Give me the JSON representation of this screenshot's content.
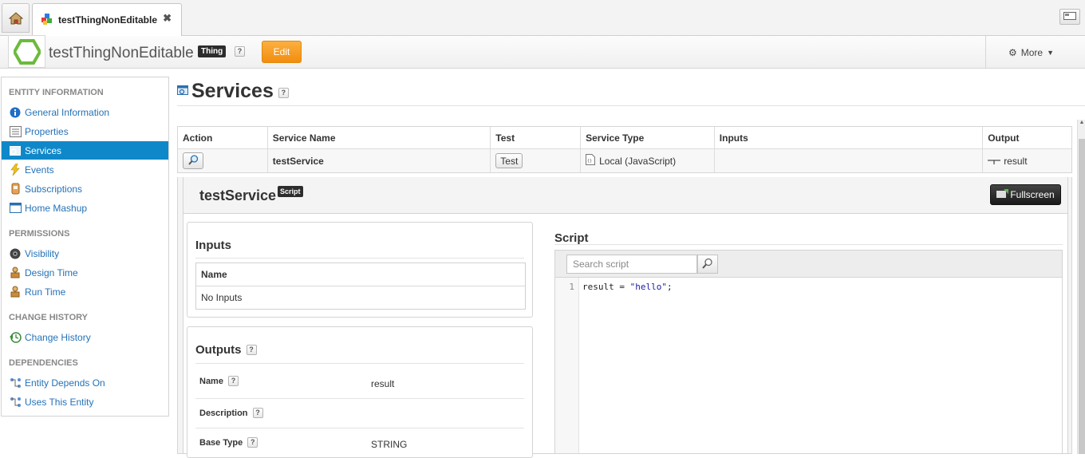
{
  "tabs": {
    "home_icon": "home-icon",
    "entity_tab_label": "testThingNonEditable",
    "close_glyph": "✖"
  },
  "header": {
    "entity_name": "testThingNonEditable",
    "type_badge": "Thing",
    "help": "?",
    "edit_label": "Edit",
    "more_label": "More",
    "accent_color": "#f28d10"
  },
  "sidebar": {
    "sections": [
      {
        "title": "ENTITY INFORMATION",
        "items": [
          {
            "label": "General Information",
            "icon": "info-icon"
          },
          {
            "label": "Properties",
            "icon": "properties-icon"
          },
          {
            "label": "Services",
            "icon": "services-icon",
            "active": true
          },
          {
            "label": "Events",
            "icon": "lightning-icon"
          },
          {
            "label": "Subscriptions",
            "icon": "subscriptions-icon"
          },
          {
            "label": "Home Mashup",
            "icon": "mashup-icon"
          }
        ]
      },
      {
        "title": "PERMISSIONS",
        "items": [
          {
            "label": "Visibility",
            "icon": "visibility-icon"
          },
          {
            "label": "Design Time",
            "icon": "design-time-icon"
          },
          {
            "label": "Run Time",
            "icon": "run-time-icon"
          }
        ]
      },
      {
        "title": "CHANGE HISTORY",
        "items": [
          {
            "label": "Change History",
            "icon": "history-icon"
          }
        ]
      },
      {
        "title": "DEPENDENCIES",
        "items": [
          {
            "label": "Entity Depends On",
            "icon": "dependency-icon"
          },
          {
            "label": "Uses This Entity",
            "icon": "dependency-icon"
          }
        ]
      }
    ],
    "active_color": "#0f88c9"
  },
  "main": {
    "title": "Services",
    "help": "?",
    "table": {
      "headers": [
        "Action",
        "Service Name",
        "Test",
        "Service Type",
        "Inputs",
        "Output"
      ],
      "row": {
        "service_name": "testService",
        "test_label": "Test",
        "service_type": "Local (JavaScript)",
        "inputs": "",
        "output": "result"
      }
    },
    "detail": {
      "title": "testService",
      "badge": "Script",
      "fullscreen_label": "Fullscreen",
      "inputs": {
        "title": "Inputs",
        "column": "Name",
        "empty": "No Inputs"
      },
      "outputs": {
        "title": "Outputs",
        "help": "?",
        "fields": [
          {
            "label": "Name",
            "value": "result"
          },
          {
            "label": "Description",
            "value": ""
          },
          {
            "label": "Base Type",
            "value": "STRING"
          }
        ]
      },
      "script": {
        "title": "Script",
        "search_placeholder": "Search script",
        "line_number": "1",
        "code_prefix": "result = ",
        "code_string": "\"hello\"",
        "code_suffix": ";"
      }
    }
  }
}
